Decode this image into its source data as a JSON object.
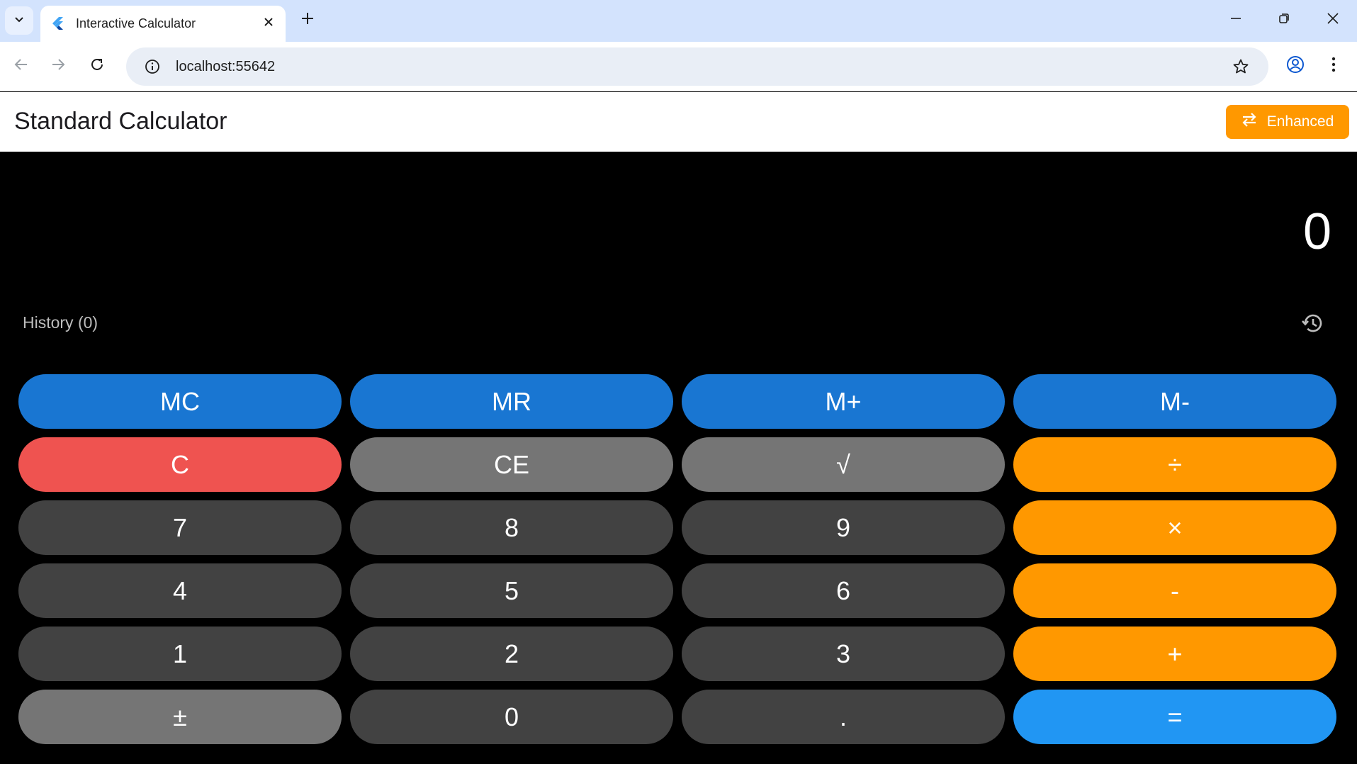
{
  "browser": {
    "tab_title": "Interactive Calculator",
    "url": "localhost:55642",
    "icons": {
      "tab_search": "chevron-down-icon",
      "favicon": "flutter-icon",
      "tab_close": "close-icon",
      "new_tab": "plus-icon",
      "back": "arrow-left-icon",
      "forward": "arrow-right-icon",
      "reload": "reload-icon",
      "site_info": "info-icon",
      "bookmark": "star-icon",
      "profile": "profile-icon",
      "menu": "kebab-menu-icon",
      "minimize": "minimize-icon",
      "restore": "restore-icon",
      "close_window": "close-icon"
    }
  },
  "appbar": {
    "title": "Standard Calculator",
    "mode_button": "Enhanced",
    "mode_button_icon": "swap-arrows-icon"
  },
  "display": {
    "value": "0"
  },
  "history": {
    "label": "History (0)",
    "icon": "history-icon"
  },
  "keys": [
    {
      "label": "MC",
      "kind": "mem"
    },
    {
      "label": "MR",
      "kind": "mem"
    },
    {
      "label": "M+",
      "kind": "mem"
    },
    {
      "label": "M-",
      "kind": "mem"
    },
    {
      "label": "C",
      "kind": "clear"
    },
    {
      "label": "CE",
      "kind": "func"
    },
    {
      "label": "√",
      "kind": "func"
    },
    {
      "label": "÷",
      "kind": "op"
    },
    {
      "label": "7",
      "kind": "num"
    },
    {
      "label": "8",
      "kind": "num"
    },
    {
      "label": "9",
      "kind": "num"
    },
    {
      "label": "×",
      "kind": "op"
    },
    {
      "label": "4",
      "kind": "num"
    },
    {
      "label": "5",
      "kind": "num"
    },
    {
      "label": "6",
      "kind": "num"
    },
    {
      "label": "-",
      "kind": "op"
    },
    {
      "label": "1",
      "kind": "num"
    },
    {
      "label": "2",
      "kind": "num"
    },
    {
      "label": "3",
      "kind": "num"
    },
    {
      "label": "+",
      "kind": "op"
    },
    {
      "label": "±",
      "kind": "func"
    },
    {
      "label": "0",
      "kind": "num"
    },
    {
      "label": ".",
      "kind": "num"
    },
    {
      "label": "=",
      "kind": "eq"
    }
  ],
  "colors": {
    "memory_key": "#1976d2",
    "clear_key": "#ef5350",
    "function_key": "#757575",
    "number_key": "#424242",
    "operator_key": "#ff9800",
    "equals_key": "#2196f3",
    "enhanced_button": "#ff9800",
    "background": "#000000"
  }
}
